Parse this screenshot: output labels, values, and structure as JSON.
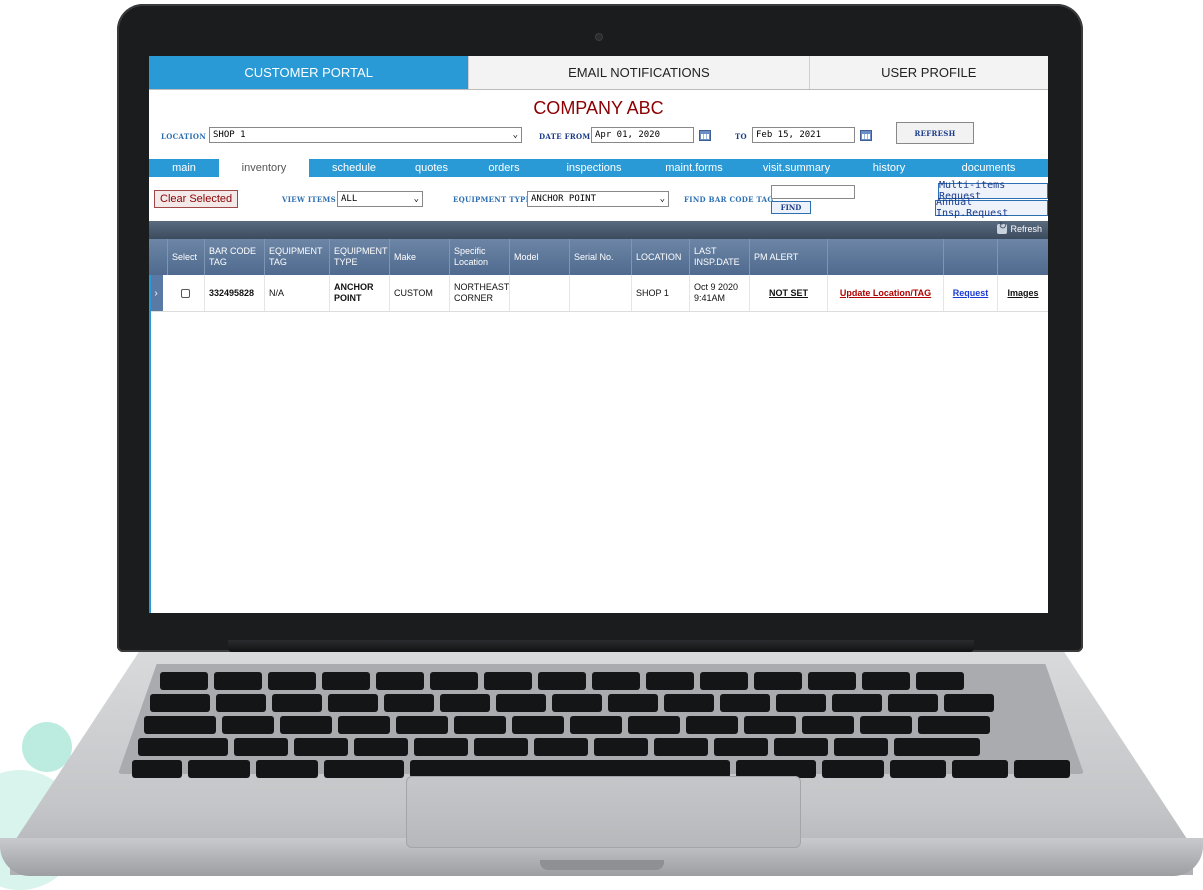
{
  "top_nav": {
    "tabs": [
      "CUSTOMER PORTAL",
      "EMAIL NOTIFICATIONS",
      "USER PROFILE"
    ],
    "active": "CUSTOMER PORTAL"
  },
  "company_name": "COMPANY ABC",
  "filters": {
    "location_label": "LOCATION",
    "location_value": "SHOP 1",
    "date_from_label": "DATE FROM",
    "date_from_value": "Apr 01, 2020",
    "to_label": "TO",
    "to_value": "Feb 15, 2021",
    "refresh_label": "REFRESH"
  },
  "sub_nav": {
    "tabs": [
      "main",
      "inventory",
      "schedule",
      "quotes",
      "orders",
      "inspections",
      "maint.forms",
      "visit.summary",
      "history",
      "documents"
    ],
    "active": "inventory"
  },
  "toolbar": {
    "clear_selected_label": "Clear Selected",
    "view_items_label": "VIEW ITEMS",
    "view_items_value": "ALL",
    "equipment_type_label": "EQUIPMENT TYPE",
    "equipment_type_value": "ANCHOR POINT",
    "find_bar_code_label": "FIND BAR CODE TAG",
    "find_bar_code_value": "",
    "find_label": "FIND",
    "multi_items_request_label": "Multi-items Request",
    "annual_insp_request_label": "Annual Insp.Request"
  },
  "grid": {
    "refresh_label": "Refresh",
    "columns": [
      "Select",
      "BAR CODE TAG",
      "EQUIPMENT TAG",
      "EQUIPMENT TYPE",
      "Make",
      "Specific Location",
      "Model",
      "Serial No.",
      "LOCATION",
      "LAST INSP.DATE",
      "PM ALERT"
    ],
    "rows": [
      {
        "bar_code_tag": "332495828",
        "equipment_tag": "N/A",
        "equipment_type": "ANCHOR POINT",
        "make": "CUSTOM",
        "specific_location": "NORTHEAST CORNER",
        "model": "",
        "serial_no": "",
        "location": "SHOP 1",
        "last_insp_date": "Oct 9 2020 9:41AM",
        "pm_alert": "NOT SET",
        "update_link": "Update Location/TAG",
        "request_link": "Request",
        "images_link": "Images"
      }
    ]
  },
  "colors": {
    "accent_blue": "#2a9ad6",
    "company_red": "#8b0000",
    "grid_header": "#5a7aa6"
  }
}
